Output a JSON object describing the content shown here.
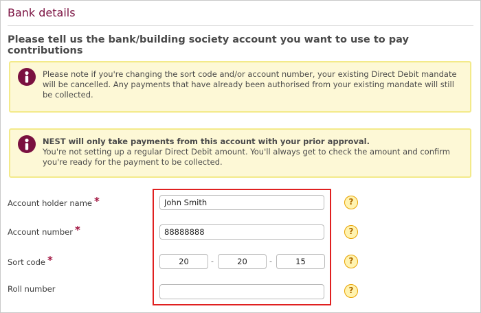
{
  "page": {
    "title": "Bank details",
    "subtitle": "Please tell us the bank/building society account you want to use to pay contributions"
  },
  "notices": [
    {
      "icon": "info-icon",
      "text": "Please note if you're changing the sort code and/or account number, your existing Direct Debit mandate will be cancelled. Any payments that have already been authorised from your existing mandate will still be collected."
    },
    {
      "icon": "info-icon",
      "heading": "NEST will only take payments from this account with your prior approval.",
      "text": "You're not setting up a regular Direct Debit amount. You'll always get to check the amount and confirm you're ready for the payment to be collected."
    }
  ],
  "form": {
    "required_marker": "*",
    "sort_separator": "-",
    "help_label": "?",
    "account_holder": {
      "label": "Account holder name",
      "value": "John Smith"
    },
    "account_number": {
      "label": "Account number",
      "value": "88888888"
    },
    "sort_code": {
      "label": "Sort code",
      "parts": [
        "20",
        "20",
        "15"
      ]
    },
    "roll_number": {
      "label": "Roll number",
      "value": ""
    }
  },
  "colors": {
    "title": "#7a1040",
    "notice_bg": "#fdf8d6",
    "notice_border": "#f3ea8a",
    "highlight": "#e02020",
    "help_icon": "#e9a300"
  }
}
